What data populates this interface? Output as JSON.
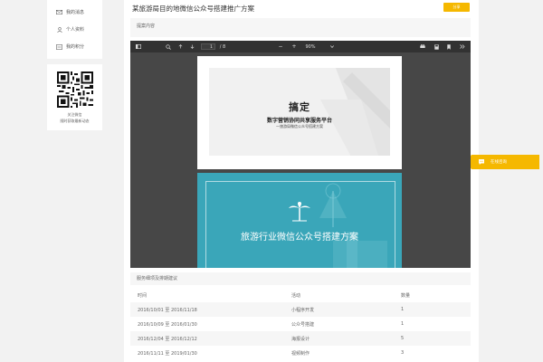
{
  "sidebar": {
    "items": [
      {
        "label": "我的消息",
        "icon": "envelope-icon"
      },
      {
        "label": "个人资料",
        "icon": "user-icon"
      },
      {
        "label": "我的积分",
        "icon": "points-icon"
      }
    ],
    "qr": {
      "caption1": "关注微信",
      "caption2": "随时获取最新动态"
    }
  },
  "page": {
    "title": "某旅游局目的地微信公众号搭建推广方案",
    "share_label": "分享"
  },
  "section1": {
    "label": "提案内容"
  },
  "viewer": {
    "page_current": "1",
    "page_total": "/ 8",
    "zoom": "90%",
    "slide1": {
      "logo": "搞定",
      "line1": "数字营销协同共享服务平台",
      "line2": "—旅游局微信公众号搭建方案"
    },
    "slide2": {
      "title": "旅游行业微信公众号搭建方案"
    }
  },
  "section2": {
    "label": "服务细项及排期建议"
  },
  "table": {
    "headers": [
      "时间",
      "活动",
      "数量"
    ],
    "rows": [
      [
        "2016/10/01 至 2016/11/18",
        "小程序开发",
        "1"
      ],
      [
        "2016/10/09 至 2016/01/30",
        "公众号搭建",
        "1"
      ],
      [
        "2016/12/04 至 2016/12/12",
        "海报设计",
        "5"
      ],
      [
        "2016/11/11 至 2019/01/30",
        "视频制作",
        "3"
      ]
    ]
  },
  "float_button": {
    "label": "在线咨询"
  },
  "colors": {
    "accent": "#f5b800",
    "viewer_bg": "#474747",
    "toolbar_bg": "#323232",
    "slide_teal": "#3aa6b9"
  }
}
